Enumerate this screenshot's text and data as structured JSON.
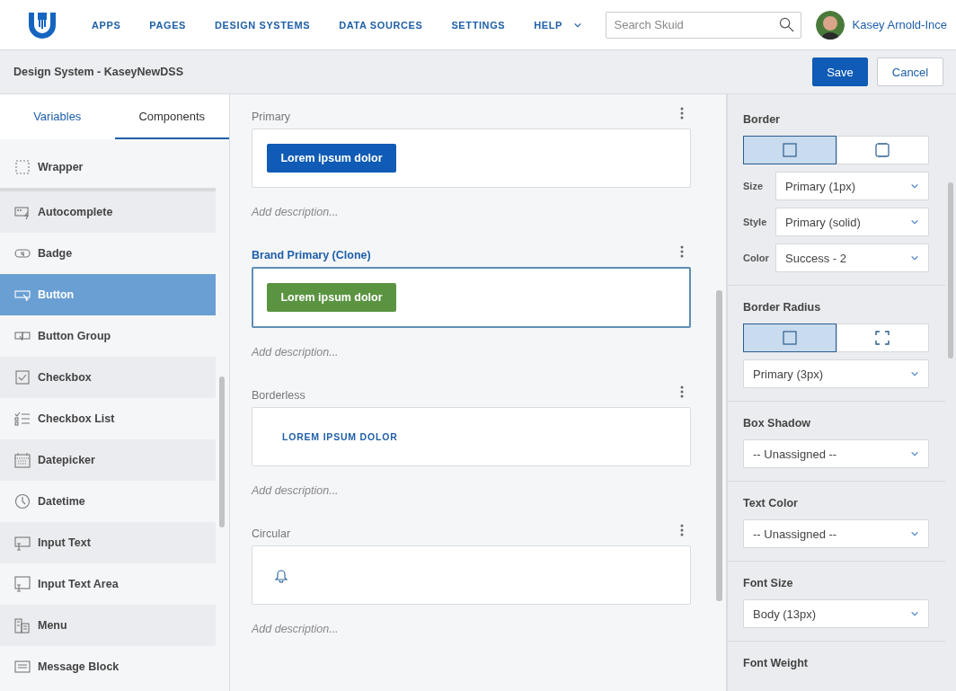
{
  "nav": {
    "items": [
      {
        "label": "APPS",
        "has_menu": false
      },
      {
        "label": "PAGES",
        "has_menu": false
      },
      {
        "label": "DESIGN SYSTEMS",
        "has_menu": false
      },
      {
        "label": "DATA SOURCES",
        "has_menu": false
      },
      {
        "label": "SETTINGS",
        "has_menu": false
      },
      {
        "label": "HELP",
        "has_menu": true
      }
    ],
    "search": {
      "placeholder": "Search Skuid"
    },
    "user": {
      "name": "Kasey Arnold-Ince"
    }
  },
  "toolbar": {
    "title": "Design System - KaseyNewDSS",
    "buttons": [
      {
        "label": "Save",
        "kind": "primary"
      },
      {
        "label": "Cancel",
        "kind": "secondary"
      }
    ]
  },
  "sidebar": {
    "tabs": [
      {
        "label": "Variables",
        "selected": false
      },
      {
        "label": "Components",
        "selected": true
      }
    ],
    "items": [
      {
        "label": "Wrapper",
        "selected": false
      },
      {
        "label": "Autocomplete",
        "selected": false
      },
      {
        "label": "Badge",
        "selected": false
      },
      {
        "label": "Button",
        "selected": true
      },
      {
        "label": "Button Group",
        "selected": false
      },
      {
        "label": "Checkbox",
        "selected": false
      },
      {
        "label": "Checkbox List",
        "selected": false
      },
      {
        "label": "Datepicker",
        "selected": false
      },
      {
        "label": "Datetime",
        "selected": false
      },
      {
        "label": "Input Text",
        "selected": false
      },
      {
        "label": "Input Text Area",
        "selected": false
      },
      {
        "label": "Menu",
        "selected": false
      },
      {
        "label": "Message Block",
        "selected": false
      }
    ]
  },
  "variants": [
    {
      "name": "Primary",
      "selected": false,
      "kind": "filled",
      "color": "#0f5bb5",
      "sample": "Lorem ipsum dolor",
      "description": "Add description..."
    },
    {
      "name": "Brand Primary (Clone)",
      "selected": true,
      "kind": "filled",
      "color": "#5a9441",
      "sample": "Lorem ipsum dolor",
      "description": "Add description..."
    },
    {
      "name": "Borderless",
      "selected": false,
      "kind": "text",
      "sample": "LOREM IPSUM DOLOR",
      "description": "Add description..."
    },
    {
      "name": "Circular",
      "selected": false,
      "kind": "icon",
      "description": "Add description..."
    }
  ],
  "properties": [
    {
      "title": "Border",
      "toggle": [
        {
          "selected": true,
          "kind": "solid"
        },
        {
          "selected": false,
          "kind": "sides"
        }
      ],
      "fields": [
        {
          "label": "Size",
          "value": "Primary (1px)"
        },
        {
          "label": "Style",
          "value": "Primary (solid)"
        },
        {
          "label": "Color",
          "value": "Success - 2"
        }
      ]
    },
    {
      "title": "Border Radius",
      "toggle": [
        {
          "selected": true,
          "kind": "solid"
        },
        {
          "selected": false,
          "kind": "corners"
        }
      ],
      "fields": [
        {
          "value": "Primary (3px)"
        }
      ]
    },
    {
      "title": "Box Shadow",
      "fields": [
        {
          "value": "-- Unassigned --"
        }
      ]
    },
    {
      "title": "Text Color",
      "fields": [
        {
          "value": "-- Unassigned --"
        }
      ]
    },
    {
      "title": "Font Size",
      "fields": [
        {
          "value": "Body (13px)"
        }
      ]
    },
    {
      "title": "Font Weight"
    }
  ]
}
